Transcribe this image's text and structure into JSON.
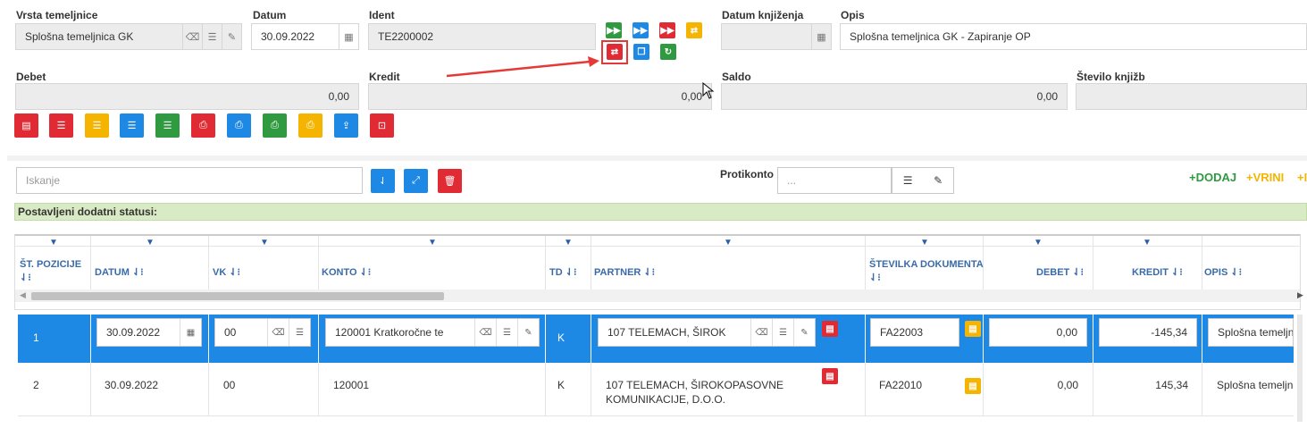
{
  "header": {
    "vrsta_label": "Vrsta temeljnice",
    "vrsta_value": "Splošna temeljnica GK",
    "datum_label": "Datum",
    "datum_value": "30.09.2022",
    "ident_label": "Ident",
    "ident_value": "TE2200002",
    "datum_knjizenja_label": "Datum knjiženja",
    "datum_knjizenja_value": "",
    "opis_label": "Opis",
    "opis_value": "Splošna temeljnica GK - Zapiranje OP",
    "debet_label": "Debet",
    "debet_value": "0,00",
    "kredit_label": "Kredit",
    "kredit_value": "0,00",
    "saldo_label": "Saldo",
    "saldo_value": "0,00",
    "stevilo_label": "Število knjižb",
    "stevilo_value": ""
  },
  "search": {
    "placeholder": "Iskanje",
    "protikonto_label": "Protikonto",
    "protikonto_placeholder": "...",
    "dodaj": "+DODAJ",
    "vrini": "+VRINI",
    "more": "+I",
    "status_label": "Postavljeni dodatni statusi:"
  },
  "columns": [
    "ŠT. POZICIJE",
    "DATUM",
    "VK",
    "KONTO",
    "TD",
    "PARTNER",
    "ŠTEVILKA DOKUMENTA",
    "DEBET",
    "KREDIT",
    "OPIS"
  ],
  "sort_icon": "⇃⁝",
  "rows": [
    {
      "poz": "1",
      "datum": "30.09.2022",
      "vk": "00",
      "konto": "120001 Kratkoročne te",
      "td": "K",
      "partner": "107 TELEMACH, ŠIROK",
      "dokument": "FA22003",
      "debet": "0,00",
      "kredit": "-145,34",
      "opis": "Splošna temeljn"
    },
    {
      "poz": "2",
      "datum": "30.09.2022",
      "vk": "00",
      "konto": "120001",
      "td": "K",
      "partner": "107 TELEMACH, ŠIROKOPASOVNE",
      "partner2": "KOMUNIKACIJE, D.O.O.",
      "dokument": "FA22010",
      "debet": "0,00",
      "kredit": "145,34",
      "opis": "Splošna temeljn"
    }
  ],
  "colors": {
    "green": "#2f9a40",
    "blue": "#1e88e5",
    "red": "#e02b35",
    "yellow": "#f5b400",
    "selected_row": "#1e88e5",
    "status_bar": "#d9ebc4"
  }
}
